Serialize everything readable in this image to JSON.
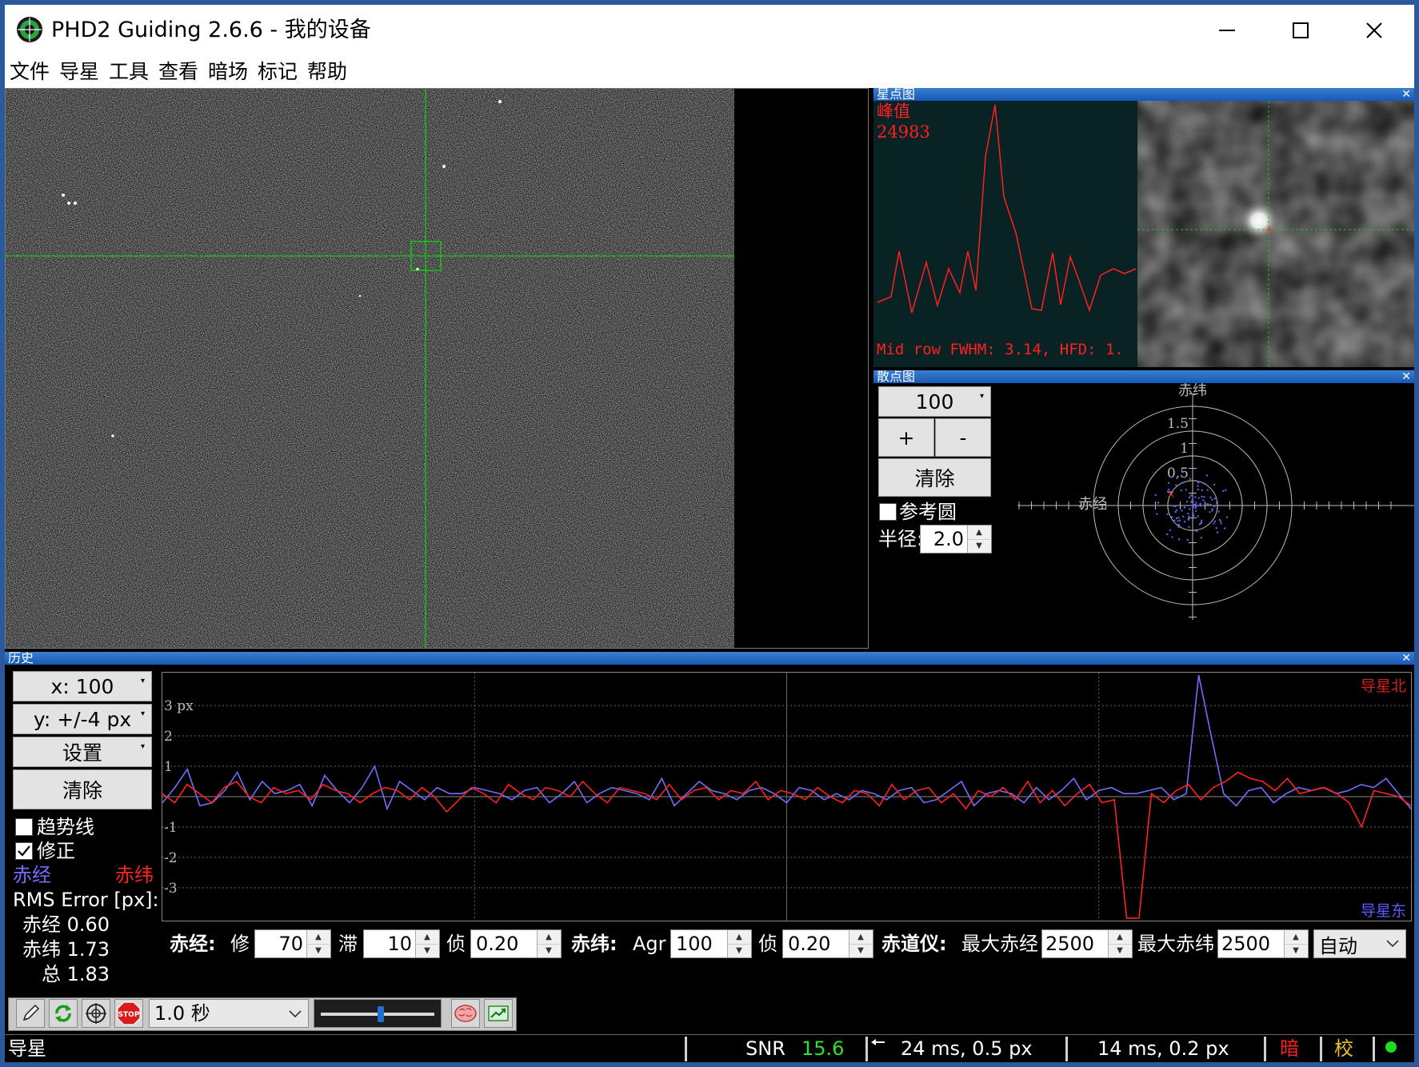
{
  "window": {
    "title": "PHD2 Guiding 2.6.6 - 我的设备",
    "app_icon": "phd2-target-icon",
    "controls": [
      "minimize-icon",
      "maximize-icon",
      "close-icon"
    ]
  },
  "menu": [
    "文件",
    "导星",
    "工具",
    "查看",
    "暗场",
    "标记",
    "帮助"
  ],
  "star_panel": {
    "title": "星点图",
    "peak_label": "峰值",
    "peak_value": "24983",
    "fwhm_text": "Mid row FWHM: 3.14, HFD: 1."
  },
  "scatter_panel": {
    "title": "散点图",
    "scale_value": "100",
    "plus_label": "+",
    "minus_label": "-",
    "clear_label": "清除",
    "ref_circle_label": "参考圆",
    "ref_circle_checked": false,
    "radius_label": "半径:",
    "radius_value": "2.0",
    "axis_dec_label": "赤纬",
    "axis_ra_label": "赤经",
    "ring_labels": [
      "1.5",
      "1",
      "0.5"
    ]
  },
  "history_panel": {
    "title": "历史",
    "x_scale": "x: 100",
    "y_scale": "y: +/-4 px",
    "settings_label": "设置",
    "clear_label": "清除",
    "trendline_label": "趋势线",
    "trendline_checked": false,
    "correction_label": "修正",
    "correction_checked": true,
    "ra_legend": "赤经",
    "dec_legend": "赤纬",
    "rms_title": "RMS Error [px]:",
    "rms_ra": "赤经 0.60",
    "rms_dec": "赤纬 1.73",
    "rms_total": "总 1.83",
    "graph_north_label": "导星北",
    "graph_east_label": "导星东",
    "y_tick_labels": [
      "3 px",
      "2",
      "1",
      "-1",
      "-2",
      "-3"
    ],
    "ra_color": "#6f6fff",
    "dec_color": "#ff2020"
  },
  "chart_data": {
    "type": "line",
    "ylim": [
      -4,
      4
    ],
    "x_range": [
      0,
      100
    ],
    "unit": "px",
    "series": [
      {
        "name": "赤经",
        "color": "#6f6fff",
        "values": [
          -0.2,
          0.3,
          0.9,
          -0.3,
          -0.2,
          0.2,
          0.8,
          -0.1,
          0.5,
          0.1,
          0.2,
          0.4,
          -0.3,
          0.7,
          0.2,
          -0.2,
          0.3,
          1.0,
          -0.4,
          0.5,
          0.2,
          -0.1,
          0.3,
          0.1,
          0.1,
          0.3,
          0.2,
          0.1,
          -0.1,
          0.2,
          0.3,
          -0.2,
          0.1,
          0.5,
          -0.2,
          0.1,
          0.3,
          0.2,
          0.1,
          -0.1,
          0.6,
          -0.3,
          0.1,
          0.5,
          0.2,
          0.1,
          -0.1,
          0.2,
          0.3,
          0.1,
          -0.2,
          0.3,
          0.2,
          -0.1,
          0.1,
          -0.1,
          0.2,
          0.1,
          -0.1,
          0.2,
          0.3,
          -0.2,
          -0.1,
          0.2,
          0.5,
          -0.3,
          0.1,
          0.2,
          0.1,
          -0.2,
          0.3,
          -0.1,
          0.2,
          0.6,
          -0.1,
          0.2,
          0.3,
          0.1,
          0.1,
          0.2,
          0.3,
          -0.1,
          0.1,
          4.0,
          2.0,
          0.1,
          -0.3,
          0.2,
          0.3,
          -0.2,
          0.1,
          0.3,
          0.2,
          0.3,
          0.1,
          0.2,
          0.4,
          0.3,
          0.6,
          0.1,
          -0.4
        ]
      },
      {
        "name": "赤纬",
        "color": "#ff2020",
        "values": [
          0.1,
          -0.2,
          0.4,
          0.1,
          -0.2,
          0.3,
          0.5,
          0.0,
          -0.2,
          0.3,
          0.1,
          0.2,
          -0.1,
          0.4,
          0.2,
          0.1,
          -0.2,
          0.1,
          0.3,
          0.2,
          -0.1,
          0.3,
          0.0,
          -0.5,
          -0.1,
          0.3,
          0.1,
          -0.2,
          0.4,
          0.1,
          -0.1,
          0.3,
          0.2,
          0.0,
          0.5,
          0.1,
          -0.2,
          0.3,
          0.2,
          0.1,
          -0.1,
          0.4,
          -0.1,
          0.2,
          0.3,
          -0.1,
          0.2,
          0.1,
          0.5,
          -0.1,
          0.2,
          0.1,
          -0.1,
          0.3,
          0.0,
          -0.2,
          0.2,
          0.1,
          -0.3,
          0.4,
          -0.1,
          0.2,
          0.3,
          -0.2,
          0.1,
          -0.4,
          0.2,
          0.0,
          0.3,
          -0.1,
          0.5,
          -0.2,
          0.2,
          -0.3,
          0.1,
          0.4,
          -0.2,
          -0.1,
          -4.0,
          -4.0,
          0.1,
          -0.2,
          0.2,
          0.4,
          -0.1,
          0.3,
          0.5,
          0.8,
          0.6,
          0.5,
          0.2,
          0.6,
          0.1,
          0.2,
          0.3,
          0.1,
          -0.2,
          -1.0,
          0.2,
          0.1,
          0.0,
          -0.3
        ]
      }
    ]
  },
  "params": {
    "ra_label": "赤经:",
    "ra_agr_label": "修",
    "ra_agr": "70",
    "ra_hyst_label": "滞",
    "ra_hyst": "10",
    "ra_min_label": "侦",
    "ra_min": "0.20",
    "dec_label": "赤纬:",
    "dec_agr_label": "Agr",
    "dec_agr": "100",
    "dec_min_label": "侦",
    "dec_min": "0.20",
    "mount_label": "赤道仪:",
    "max_ra_label": "最大赤经",
    "max_ra": "2500",
    "max_dec_label": "最大赤纬",
    "max_dec": "2500",
    "dec_mode": "自动"
  },
  "toolbar": {
    "exposure": "1.0 秒",
    "gamma_level": 0.52,
    "icons": [
      "pencil-icon",
      "loop-icon",
      "crosshair-icon",
      "stop-icon",
      "brain-icon",
      "guide-icon"
    ]
  },
  "statusbar": {
    "mode": "导星",
    "snr_label": "SNR",
    "snr_value": "15.6",
    "ra_pulse": "24 ms, 0.5 px",
    "dec_pulse": "14 ms, 0.2 px",
    "dark": "暗",
    "cal": "校"
  }
}
